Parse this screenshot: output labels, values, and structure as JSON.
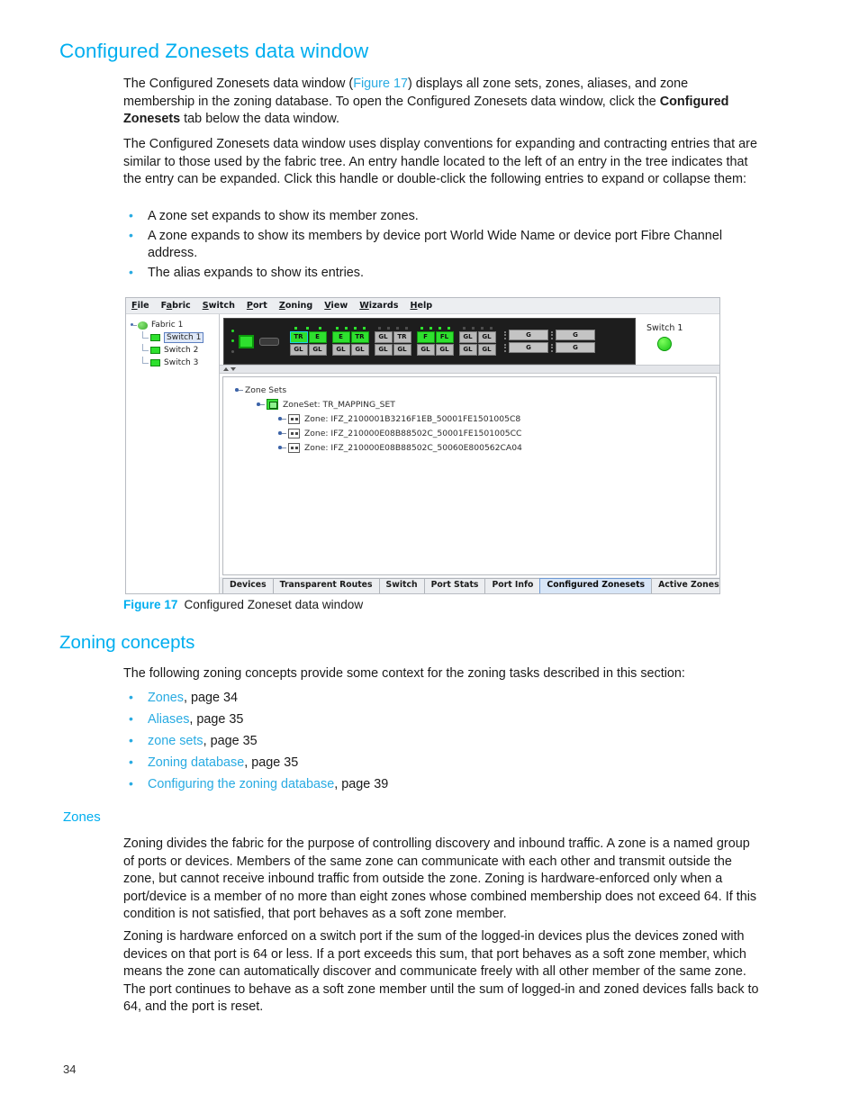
{
  "page": {
    "number": "34",
    "section_title": "Configured Zonesets data window",
    "sub_title": "Zoning concepts",
    "minor_title": "Zones"
  },
  "intro": {
    "p1_a": "The Configured Zonesets data window (",
    "p1_link": "Figure 17",
    "p1_b": ") displays all zone sets, zones, aliases, and zone membership in the zoning database. To open the Configured Zonesets data window, click the ",
    "p1_bold": "Configured Zonesets",
    "p1_c": " tab below the data window.",
    "p2": "The Configured Zonesets data window uses display conventions for expanding and contracting entries that are similar to those used by the fabric tree. An entry handle located to the left of an entry in the tree indicates that the entry can be expanded. Click this handle or double-click the following entries to expand or collapse them:"
  },
  "expand_bullets": [
    "A zone set expands to show its member zones.",
    "A zone expands to show its members by device port World Wide Name or device port Fibre Channel address.",
    "The alias expands to show its entries."
  ],
  "figure": {
    "number_label": "Figure 17",
    "caption": "Configured Zoneset data window"
  },
  "app": {
    "menu": [
      {
        "label": "File",
        "mnemonic": "F"
      },
      {
        "label": "Fabric",
        "mnemonic": "a"
      },
      {
        "label": "Switch",
        "mnemonic": "S"
      },
      {
        "label": "Port",
        "mnemonic": "P"
      },
      {
        "label": "Zoning",
        "mnemonic": "Z"
      },
      {
        "label": "View",
        "mnemonic": "V"
      },
      {
        "label": "Wizards",
        "mnemonic": "W"
      },
      {
        "label": "Help",
        "mnemonic": "H"
      }
    ],
    "fabric_tree": {
      "root": "Fabric 1",
      "children": [
        {
          "label": "Switch 1",
          "selected": true
        },
        {
          "label": "Switch 2",
          "selected": false
        },
        {
          "label": "Switch 3",
          "selected": false
        }
      ]
    },
    "faceplate": {
      "switch_name": "Switch 1",
      "port_groups": [
        {
          "leds": [
            "on",
            "on",
            "on"
          ],
          "top": [
            {
              "label": "TR",
              "state": "active",
              "selected": true
            },
            {
              "label": "E",
              "state": "active",
              "selected": false
            }
          ],
          "bottom": [
            {
              "label": "GL",
              "state": "idle",
              "selected": false
            },
            {
              "label": "GL",
              "state": "idle",
              "selected": false
            }
          ]
        },
        {
          "leds": [
            "on",
            "on",
            "on",
            "on"
          ],
          "top": [
            {
              "label": "E",
              "state": "active",
              "selected": false
            },
            {
              "label": "TR",
              "state": "active",
              "selected": false
            }
          ],
          "bottom": [
            {
              "label": "GL",
              "state": "idle",
              "selected": false
            },
            {
              "label": "GL",
              "state": "idle",
              "selected": false
            }
          ]
        },
        {
          "leds": [
            "off",
            "off",
            "off",
            "off"
          ],
          "top": [
            {
              "label": "GL",
              "state": "idle",
              "selected": false
            },
            {
              "label": "TR",
              "state": "idle",
              "selected": false
            }
          ],
          "bottom": [
            {
              "label": "GL",
              "state": "idle",
              "selected": false
            },
            {
              "label": "GL",
              "state": "idle",
              "selected": false
            }
          ]
        },
        {
          "leds": [
            "on",
            "on",
            "on",
            "on"
          ],
          "top": [
            {
              "label": "F",
              "state": "active",
              "selected": false
            },
            {
              "label": "FL",
              "state": "active",
              "selected": false
            }
          ],
          "bottom": [
            {
              "label": "GL",
              "state": "idle",
              "selected": false
            },
            {
              "label": "GL",
              "state": "idle",
              "selected": false
            }
          ]
        },
        {
          "leds": [
            "off",
            "off",
            "off",
            "off"
          ],
          "top": [
            {
              "label": "GL",
              "state": "idle",
              "selected": false
            },
            {
              "label": "GL",
              "state": "idle",
              "selected": false
            }
          ],
          "bottom": [
            {
              "label": "GL",
              "state": "idle",
              "selected": false
            },
            {
              "label": "GL",
              "state": "idle",
              "selected": false
            }
          ]
        }
      ],
      "g_ports": [
        [
          "G",
          "G"
        ],
        [
          "G",
          "G"
        ]
      ]
    },
    "data_window": {
      "root_label": "Zone Sets",
      "zoneset_label": "ZoneSet: TR_MAPPING_SET",
      "zones": [
        "Zone: IFZ_2100001B3216F1EB_50001FE1501005C8",
        "Zone: IFZ_210000E08B88502C_50001FE1501005CC",
        "Zone: IFZ_210000E08B88502C_50060E800562CA04"
      ]
    },
    "tabs": [
      {
        "label": "Devices",
        "active": false
      },
      {
        "label": "Transparent Routes",
        "active": false
      },
      {
        "label": "Switch",
        "active": false
      },
      {
        "label": "Port Stats",
        "active": false
      },
      {
        "label": "Port Info",
        "active": false
      },
      {
        "label": "Configured Zonesets",
        "active": true
      },
      {
        "label": "Active Zoneset",
        "active": false
      }
    ]
  },
  "zoning_concepts": {
    "intro": "The following zoning concepts provide some context for the zoning tasks described in this section:",
    "links": [
      {
        "link": "Zones",
        "rest": ", page 34"
      },
      {
        "link": "Aliases",
        "rest": ", page 35"
      },
      {
        "link": "zone sets",
        "rest": ", page 35"
      },
      {
        "link": "Zoning database",
        "rest": ", page 35"
      },
      {
        "link": "Configuring the zoning database",
        "rest": ", page 39"
      }
    ]
  },
  "zones_section": {
    "p1": "Zoning divides the fabric for the purpose of controlling discovery and inbound traffic. A zone is a named group of ports or devices. Members of the same zone can communicate with each other and transmit outside the zone, but cannot receive inbound traffic from outside the zone. Zoning is hardware-enforced only when a port/device is a member of no more than eight zones whose combined membership does not exceed 64. If this condition is not satisfied, that port behaves as a soft zone member.",
    "p2": "Zoning is hardware enforced on a switch port if the sum of the logged-in devices plus the devices zoned with devices on that port is 64 or less. If a port exceeds this sum, that port behaves as a soft zone member, which means the zone can automatically discover and communicate freely with all other member of the same zone. The port continues to behave as a soft zone member until the sum of logged-in and zoned devices falls back to 64, and the port is reset."
  },
  "colors": {
    "accent": "#00AEEF",
    "link": "#29ABE2"
  }
}
